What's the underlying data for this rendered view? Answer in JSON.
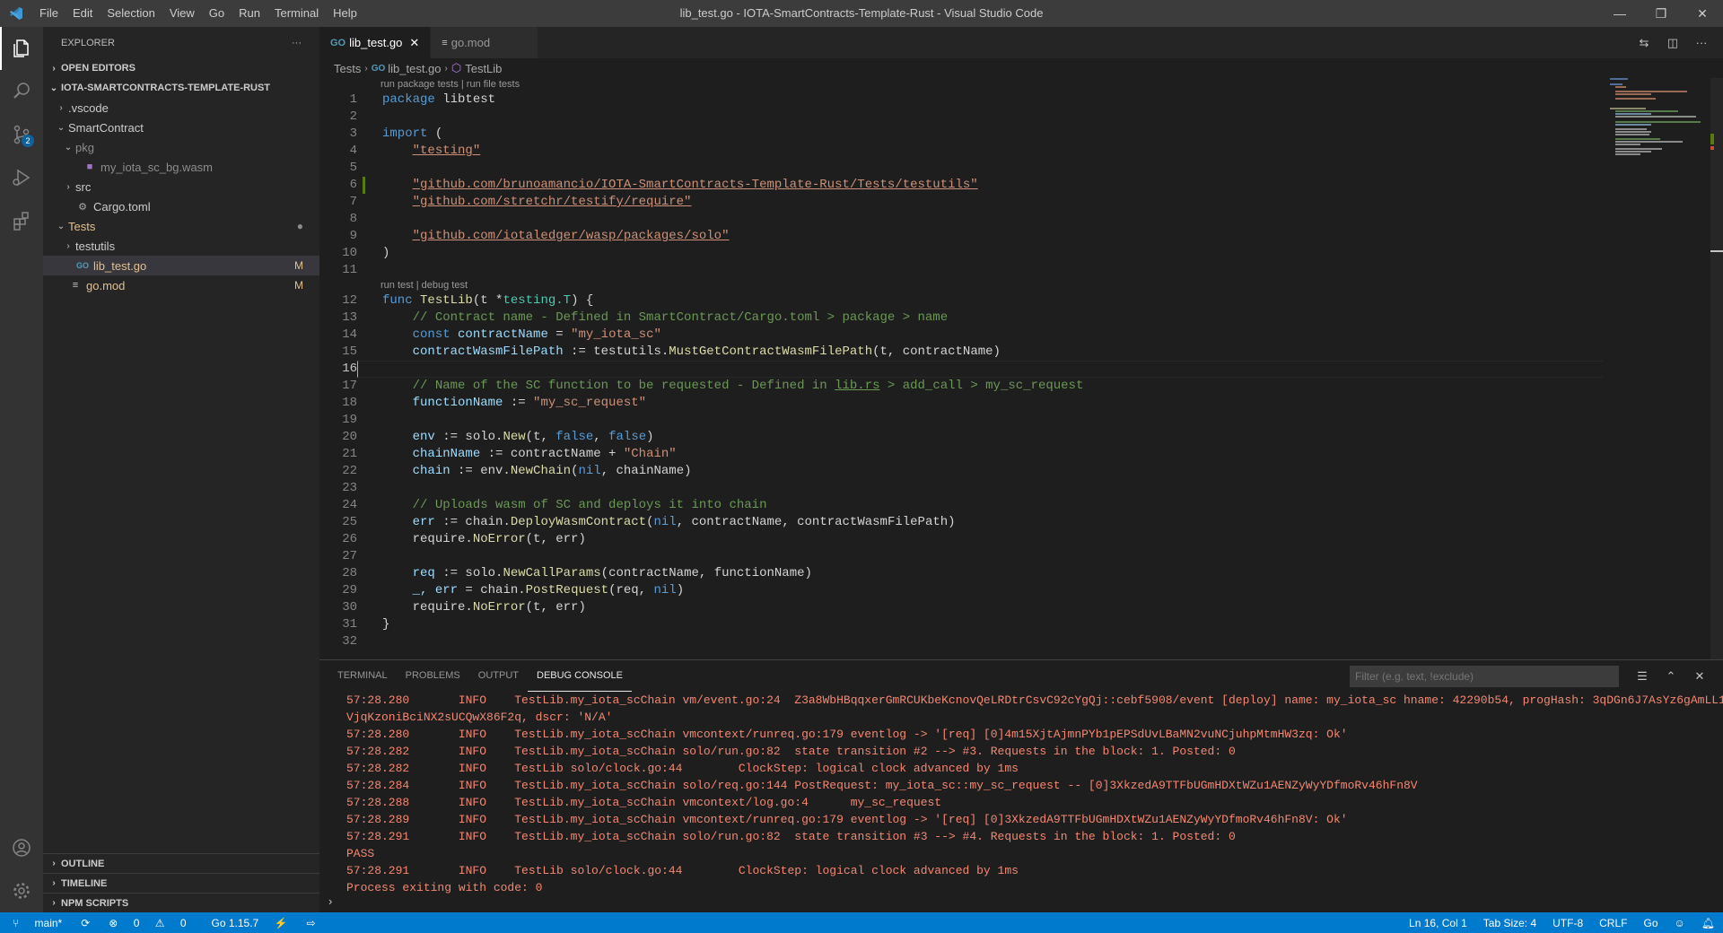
{
  "titlebar": {
    "menu": [
      "File",
      "Edit",
      "Selection",
      "View",
      "Go",
      "Run",
      "Terminal",
      "Help"
    ],
    "title": "lib_test.go - IOTA-SmartContracts-Template-Rust - Visual Studio Code"
  },
  "activity": {
    "source_control_badge": "2"
  },
  "sidebar": {
    "header": "EXPLORER",
    "more": "···",
    "open_editors": "OPEN EDITORS",
    "workspace": "IOTA-SMARTCONTRACTS-TEMPLATE-RUST",
    "tree": [
      {
        "label": ".vscode",
        "indent": 1,
        "chevron": "›",
        "deco": ""
      },
      {
        "label": "SmartContract",
        "indent": 1,
        "chevron": "⌄",
        "deco": ""
      },
      {
        "label": "pkg",
        "indent": 2,
        "chevron": "⌄",
        "deco": ""
      },
      {
        "label": "my_iota_sc_bg.wasm",
        "indent": 3,
        "chevron": "",
        "deco": ""
      },
      {
        "label": "src",
        "indent": 2,
        "chevron": "›",
        "deco": ""
      },
      {
        "label": "Cargo.toml",
        "indent": 2,
        "chevron": "",
        "deco": ""
      },
      {
        "label": "Tests",
        "indent": 1,
        "chevron": "⌄",
        "deco": "●"
      },
      {
        "label": "testutils",
        "indent": 2,
        "chevron": "›",
        "deco": ""
      },
      {
        "label": "lib_test.go",
        "indent": 2,
        "chevron": "",
        "deco": "M"
      },
      {
        "label": "go.mod",
        "indent": 1,
        "chevron": "",
        "deco": "M"
      }
    ],
    "outline": "OUTLINE",
    "timeline": "TIMELINE",
    "npm_scripts": "NPM SCRIPTS"
  },
  "editor": {
    "tabs": [
      {
        "label": "lib_test.go",
        "active": true
      },
      {
        "label": "go.mod",
        "active": false
      }
    ],
    "breadcrumb": [
      "Tests",
      "lib_test.go",
      "TestLib"
    ],
    "codelens_package": "run package tests | run file tests",
    "codelens_func": "run test | debug test",
    "lines": [
      "1",
      "2",
      "3",
      "4",
      "5",
      "6",
      "7",
      "8",
      "9",
      "10",
      "11",
      "12",
      "13",
      "14",
      "15",
      "16",
      "17",
      "18",
      "19",
      "20",
      "21",
      "22",
      "23",
      "24",
      "25",
      "26",
      "27",
      "28",
      "29",
      "30",
      "31",
      "32"
    ],
    "code": {
      "l1_kw": "package",
      "l1_rest": " libtest",
      "l3_kw": "import",
      "l3_rest": " (",
      "l4": "\"testing\"",
      "l6": "\"github.com/brunoamancio/IOTA-SmartContracts-Template-Rust/Tests/testutils\"",
      "l7": "\"github.com/stretchr/testify/require\"",
      "l9": "\"github.com/iotaledger/wasp/packages/solo\"",
      "l10": ")",
      "l12_kw": "func",
      "l12_fn": "TestLib",
      "l12_rest1": "(t *",
      "l12_ty": "testing.T",
      "l12_rest2": ") {",
      "l13": "// Contract name - Defined in SmartContract/Cargo.toml > package > name",
      "l14_kw": "const",
      "l14_var": "contractName",
      "l14_eq": " = ",
      "l14_str": "\"my_iota_sc\"",
      "l15_var": "contractWasmFilePath",
      "l15_rest1": " := testutils.",
      "l15_fn": "MustGetContractWasmFilePath",
      "l15_rest2": "(t, contractName)",
      "l17a": "// Name of the SC function to be requested - Defined in ",
      "l17b": "lib.rs",
      "l17c": " > add_call > my_sc_request",
      "l18_var": "functionName",
      "l18_eq": " := ",
      "l18_str": "\"my_sc_request\"",
      "l20_var": "env",
      "l20_rest1": " := solo.",
      "l20_fn": "New",
      "l20_rest2": "(t, ",
      "l20_k1": "false",
      "l20_rest3": ", ",
      "l20_k2": "false",
      "l20_rest4": ")",
      "l21_var": "chainName",
      "l21_rest": " := contractName + ",
      "l21_str": "\"Chain\"",
      "l22_var": "chain",
      "l22_rest1": " := env.",
      "l22_fn": "NewChain",
      "l22_rest2": "(",
      "l22_k": "nil",
      "l22_rest3": ", chainName)",
      "l24": "// Uploads wasm of SC and deploys it into chain",
      "l25_var": "err",
      "l25_rest1": " := chain.",
      "l25_fn": "DeployWasmContract",
      "l25_rest2": "(",
      "l25_k": "nil",
      "l25_rest3": ", contractName, contractWasmFilePath)",
      "l26_rest1": "require.",
      "l26_fn": "NoError",
      "l26_rest2": "(t, err)",
      "l28_var": "req",
      "l28_rest1": " := solo.",
      "l28_fn": "NewCallParams",
      "l28_rest2": "(contractName, functionName)",
      "l29_var": "_, err",
      "l29_rest1": " = chain.",
      "l29_fn": "PostRequest",
      "l29_rest2": "(req, ",
      "l29_k": "nil",
      "l29_rest3": ")",
      "l30_rest1": "require.",
      "l30_fn": "NoError",
      "l30_rest2": "(t, err)",
      "l31": "}"
    }
  },
  "panel": {
    "tabs": [
      "TERMINAL",
      "PROBLEMS",
      "OUTPUT",
      "DEBUG CONSOLE"
    ],
    "filter_placeholder": "Filter (e.g. text, !exclude)",
    "console": [
      "57:28.280       INFO    TestLib.my_iota_scChain vm/event.go:24  Z3a8WbHBqqxerGmRCUKbeKcnovQeLRDtrCsvC92cYgQj::cebf5908/event [deploy] name: my_iota_sc hname: 42290b54, progHash: 3qDGn6J7AsYz6gAmLL1",
      "VjqKzoniBciNX2sUCQwX86F2q, dscr: 'N/A'",
      "57:28.280       INFO    TestLib.my_iota_scChain vmcontext/runreq.go:179 eventlog -> '[req] [0]4m15XjtAjmnPYb1pEPSdUvLBaMN2vuNCjuhpMtmHW3zq: Ok'",
      "57:28.282       INFO    TestLib.my_iota_scChain solo/run.go:82  state transition #2 --> #3. Requests in the block: 1. Posted: 0",
      "57:28.282       INFO    TestLib solo/clock.go:44        ClockStep: logical clock advanced by 1ms",
      "57:28.284       INFO    TestLib.my_iota_scChain solo/req.go:144 PostRequest: my_iota_sc::my_sc_request -- [0]3XkzedA9TTFbUGmHDXtWZu1AENZyWyYDfmoRv46hFn8V",
      "57:28.288       INFO    TestLib.my_iota_scChain vmcontext/log.go:4      my_sc_request",
      "57:28.289       INFO    TestLib.my_iota_scChain vmcontext/runreq.go:179 eventlog -> '[req] [0]3XkzedA9TTFbUGmHDXtWZu1AENZyWyYDfmoRv46hFn8V: Ok'",
      "57:28.291       INFO    TestLib.my_iota_scChain solo/run.go:82  state transition #3 --> #4. Requests in the block: 1. Posted: 0",
      "PASS",
      "57:28.291       INFO    TestLib solo/clock.go:44        ClockStep: logical clock advanced by 1ms",
      "Process exiting with code: 0"
    ],
    "prompt": "›"
  },
  "statusbar": {
    "branch": "main*",
    "errors": "0",
    "warnings": "0",
    "go_version": "Go 1.15.7",
    "position": "Ln 16, Col 1",
    "tab_size": "Tab Size: 4",
    "encoding": "UTF-8",
    "eol": "CRLF",
    "language": "Go"
  },
  "colors": {
    "accent": "#007acc",
    "console_text": "#f48771",
    "modified": "#e2c08d"
  }
}
